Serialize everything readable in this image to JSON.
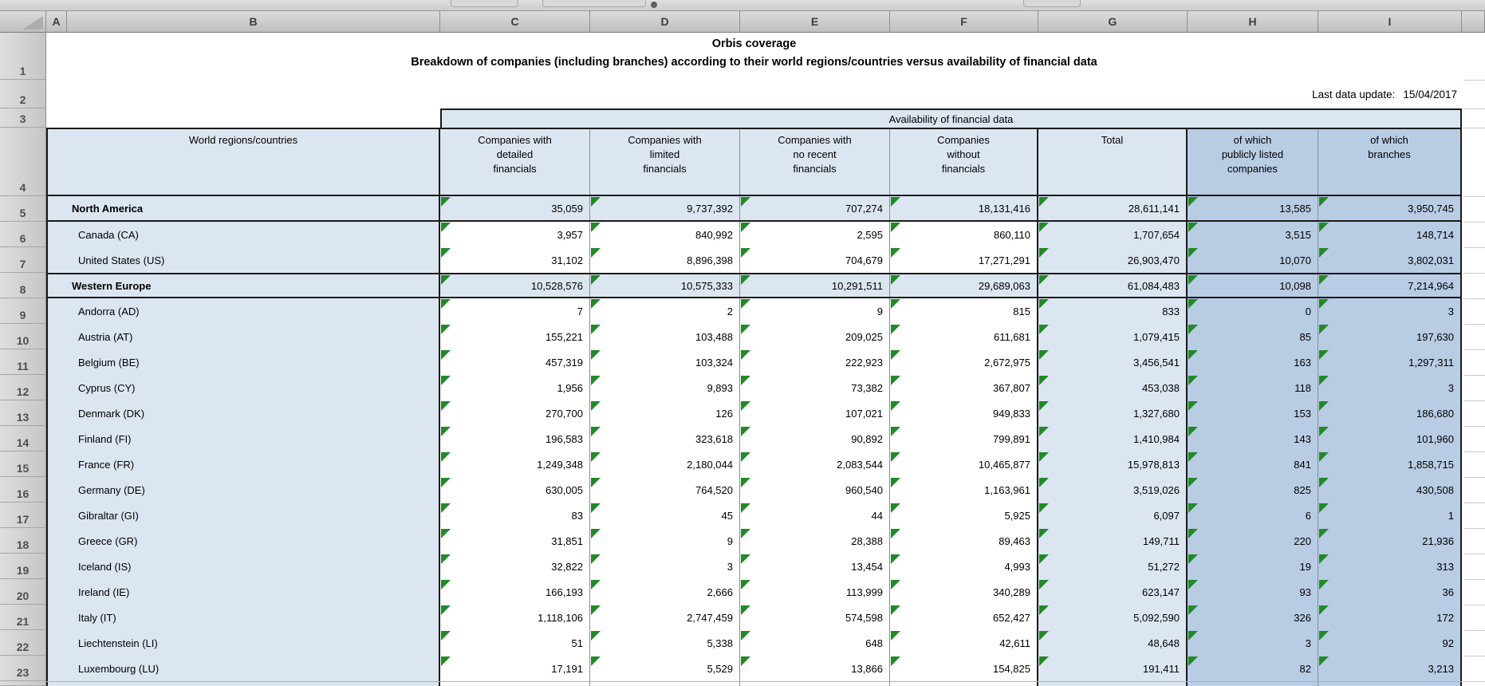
{
  "colors": {
    "fill_light_blue": "#dce6f1",
    "fill_medium_blue": "#b8cce4",
    "flag_green": "#1f8b24",
    "border_dark": "#1a1a1a",
    "grid_grey": "#8c8c8c"
  },
  "title": {
    "line1": "Orbis coverage",
    "line2": "Breakdown of companies (including branches) according to their world regions/countries versus availability of financial data"
  },
  "last_update": {
    "label": "Last data update:",
    "value": "15/04/2017"
  },
  "grid": {
    "column_letters": [
      "A",
      "B",
      "C",
      "D",
      "E",
      "F",
      "G",
      "H",
      "I"
    ],
    "row_numbers": [
      "1",
      "2",
      "3",
      "4",
      "5",
      "6",
      "7",
      "8",
      "9",
      "10",
      "11",
      "12",
      "13",
      "14",
      "15",
      "16",
      "17",
      "18",
      "19",
      "20",
      "21",
      "22",
      "23"
    ]
  },
  "table": {
    "band_header": "Availability of financial data",
    "row_header": "World regions/countries",
    "column_headers": [
      "Companies with\ndetailed\nfinancials",
      "Companies with\nlimited\nfinancials",
      "Companies with\nno recent\nfinancials",
      "Companies\nwithout\nfinancials",
      "Total",
      "of which\npublicly listed\ncompanies",
      "of which\nbranches"
    ],
    "rows": [
      {
        "label": "North America",
        "region": true,
        "values": [
          "35,059",
          "9,737,392",
          "707,274",
          "18,131,416",
          "28,611,141",
          "13,585",
          "3,950,745"
        ]
      },
      {
        "label": "Canada (CA)",
        "region": false,
        "values": [
          "3,957",
          "840,992",
          "2,595",
          "860,110",
          "1,707,654",
          "3,515",
          "148,714"
        ]
      },
      {
        "label": "United States (US)",
        "region": false,
        "values": [
          "31,102",
          "8,896,398",
          "704,679",
          "17,271,291",
          "26,903,470",
          "10,070",
          "3,802,031"
        ]
      },
      {
        "label": "Western Europe",
        "region": true,
        "values": [
          "10,528,576",
          "10,575,333",
          "10,291,511",
          "29,689,063",
          "61,084,483",
          "10,098",
          "7,214,964"
        ]
      },
      {
        "label": "Andorra (AD)",
        "region": false,
        "values": [
          "7",
          "2",
          "9",
          "815",
          "833",
          "0",
          "3"
        ]
      },
      {
        "label": "Austria (AT)",
        "region": false,
        "values": [
          "155,221",
          "103,488",
          "209,025",
          "611,681",
          "1,079,415",
          "85",
          "197,630"
        ]
      },
      {
        "label": "Belgium (BE)",
        "region": false,
        "values": [
          "457,319",
          "103,324",
          "222,923",
          "2,672,975",
          "3,456,541",
          "163",
          "1,297,311"
        ]
      },
      {
        "label": "Cyprus (CY)",
        "region": false,
        "values": [
          "1,956",
          "9,893",
          "73,382",
          "367,807",
          "453,038",
          "118",
          "3"
        ]
      },
      {
        "label": "Denmark (DK)",
        "region": false,
        "values": [
          "270,700",
          "126",
          "107,021",
          "949,833",
          "1,327,680",
          "153",
          "186,680"
        ]
      },
      {
        "label": "Finland (FI)",
        "region": false,
        "values": [
          "196,583",
          "323,618",
          "90,892",
          "799,891",
          "1,410,984",
          "143",
          "101,960"
        ]
      },
      {
        "label": "France (FR)",
        "region": false,
        "values": [
          "1,249,348",
          "2,180,044",
          "2,083,544",
          "10,465,877",
          "15,978,813",
          "841",
          "1,858,715"
        ]
      },
      {
        "label": "Germany (DE)",
        "region": false,
        "values": [
          "630,005",
          "764,520",
          "960,540",
          "1,163,961",
          "3,519,026",
          "825",
          "430,508"
        ]
      },
      {
        "label": "Gibraltar (GI)",
        "region": false,
        "values": [
          "83",
          "45",
          "44",
          "5,925",
          "6,097",
          "6",
          "1"
        ]
      },
      {
        "label": "Greece (GR)",
        "region": false,
        "values": [
          "31,851",
          "9",
          "28,388",
          "89,463",
          "149,711",
          "220",
          "21,936"
        ]
      },
      {
        "label": "Iceland (IS)",
        "region": false,
        "values": [
          "32,822",
          "3",
          "13,454",
          "4,993",
          "51,272",
          "19",
          "313"
        ]
      },
      {
        "label": "Ireland (IE)",
        "region": false,
        "values": [
          "166,193",
          "2,666",
          "113,999",
          "340,289",
          "623,147",
          "93",
          "36"
        ]
      },
      {
        "label": "Italy (IT)",
        "region": false,
        "values": [
          "1,118,106",
          "2,747,459",
          "574,598",
          "652,427",
          "5,092,590",
          "326",
          "172"
        ]
      },
      {
        "label": "Liechtenstein (LI)",
        "region": false,
        "values": [
          "51",
          "5,338",
          "648",
          "42,611",
          "48,648",
          "3",
          "92"
        ]
      },
      {
        "label": "Luxembourg (LU)",
        "region": false,
        "values": [
          "17,191",
          "5,529",
          "13,866",
          "154,825",
          "191,411",
          "82",
          "3,213"
        ]
      }
    ]
  }
}
